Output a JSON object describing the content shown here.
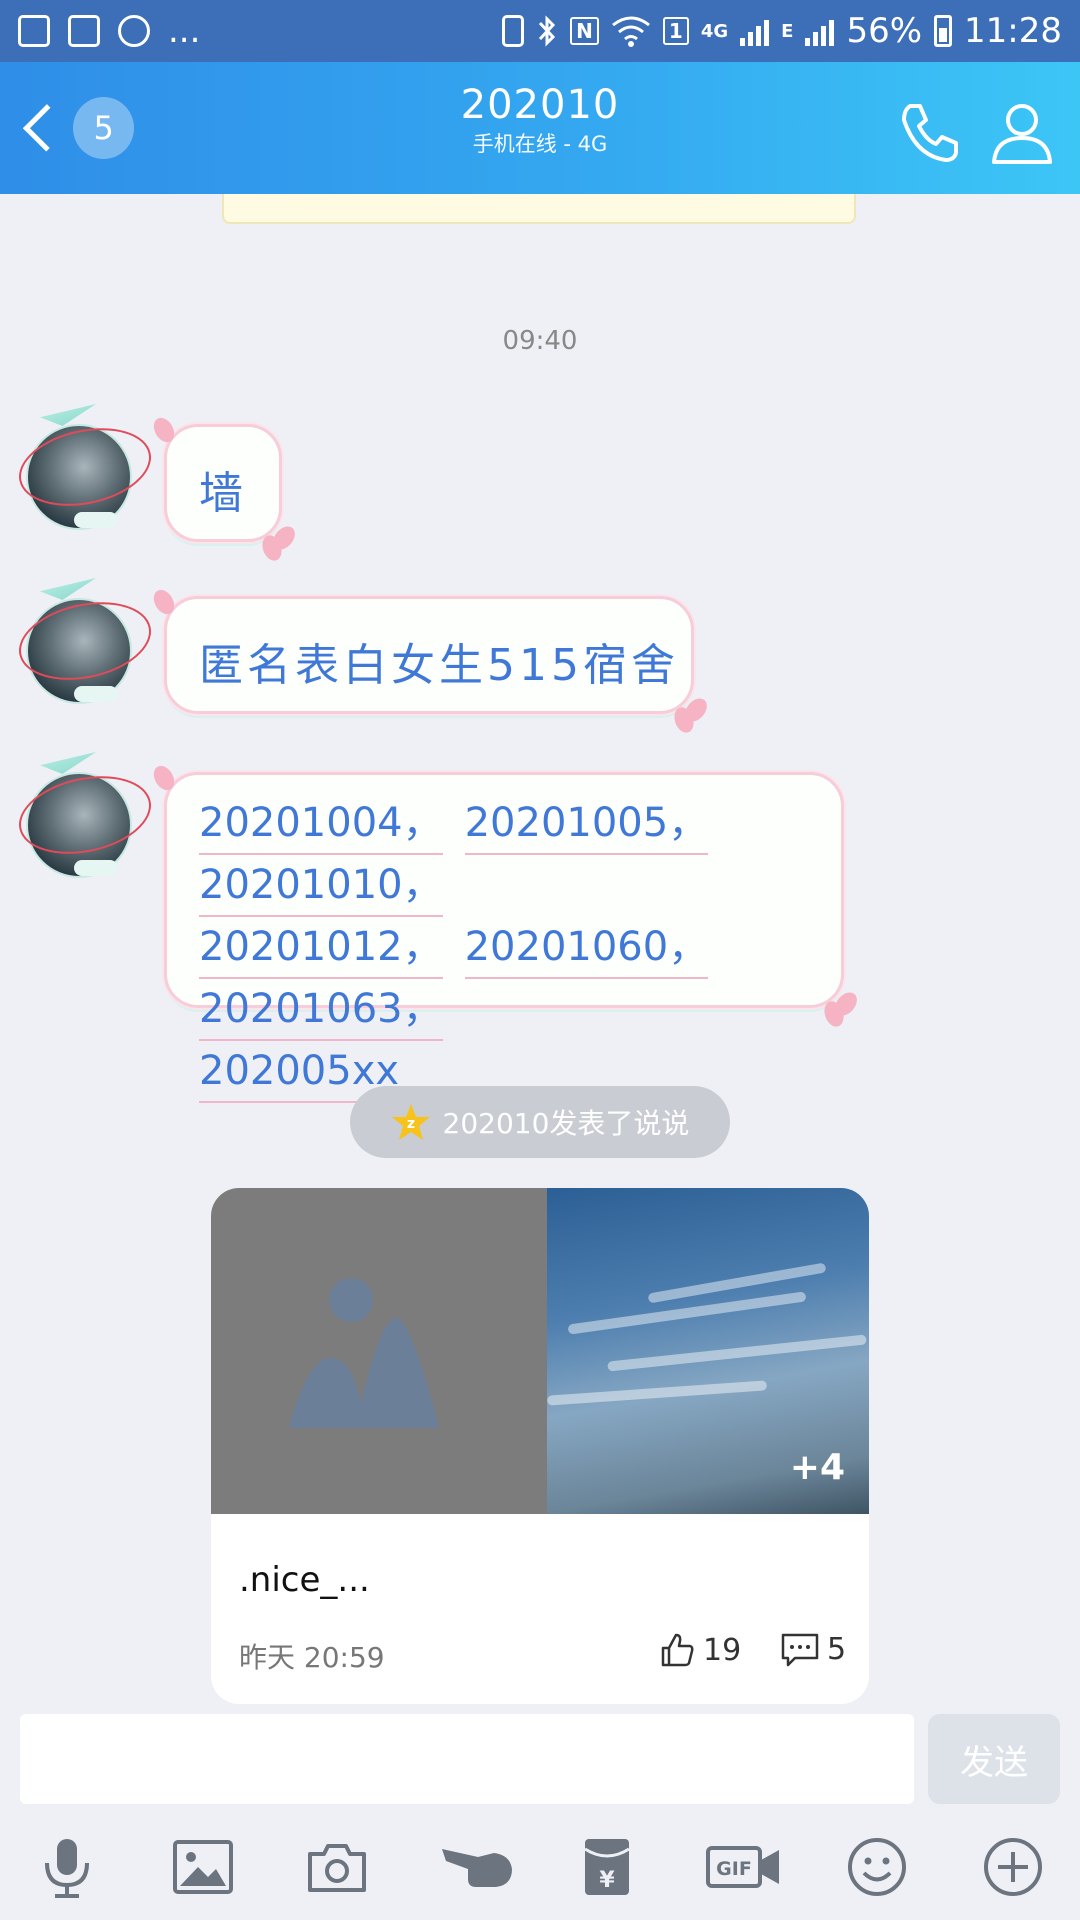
{
  "status_bar": {
    "left_more": "...",
    "sim_badge": "1",
    "net_4g": "4G",
    "net_e": "E",
    "battery": "56%",
    "time": "11:28"
  },
  "header": {
    "back_count": "5",
    "title": "202010",
    "subtitle": "手机在线 - 4G"
  },
  "chat": {
    "time_label": "09:40",
    "messages": [
      {
        "text": "墙"
      },
      {
        "text": "匿名表白女生515宿舍"
      },
      {
        "lines": [
          [
            "20201004，",
            "20201005，",
            "20201010，"
          ],
          [
            "20201012，",
            "20201060，",
            "20201063，"
          ],
          [
            "202005xx"
          ]
        ]
      }
    ]
  },
  "notice": {
    "text": "202010发表了说说",
    "icon": "qzone-star-icon"
  },
  "feed_card": {
    "more_photos": "+4",
    "title": ".nice_...",
    "time": "昨天 20:59",
    "likes": "19",
    "comments": "5"
  },
  "input": {
    "value": "",
    "placeholder": "",
    "send_label": "发送"
  },
  "toolbar": {
    "gif_label": "GIF",
    "icons": [
      "microphone-icon",
      "image-icon",
      "camera-icon",
      "poke-hand-icon",
      "red-packet-icon",
      "gif-icon",
      "emoji-icon",
      "plus-icon"
    ]
  },
  "colors": {
    "header_gradient_start": "#2f8ee8",
    "header_gradient_end": "#3cc6f6",
    "status_bar": "#3d6fb8",
    "bubble_text": "#3f78d6",
    "background": "#eef0f5"
  }
}
